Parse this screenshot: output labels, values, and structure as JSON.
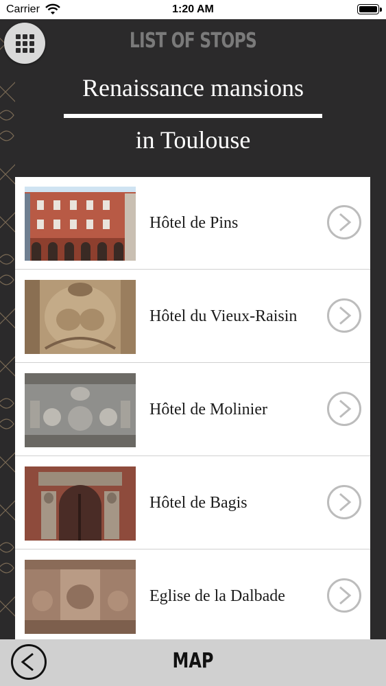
{
  "status_bar": {
    "carrier": "Carrier",
    "time": "1:20 AM"
  },
  "header": {
    "title": "LIST OF STOPS",
    "menu_icon": "grid-icon"
  },
  "tour": {
    "title_line1": "Renaissance mansions",
    "title_line2": "in Toulouse"
  },
  "stops": [
    {
      "name": "Hôtel de Pins"
    },
    {
      "name": "Hôtel du Vieux-Raisin"
    },
    {
      "name": "Hôtel de Molinier"
    },
    {
      "name": "Hôtel de Bagis"
    },
    {
      "name": "Eglise de la Dalbade"
    }
  ],
  "footer": {
    "map_label": "MAP",
    "back_icon": "chevron-left-circle-icon"
  },
  "colors": {
    "background": "#2b2a2b",
    "footer": "#d0d0d0",
    "chevron": "#bcbcbc"
  }
}
